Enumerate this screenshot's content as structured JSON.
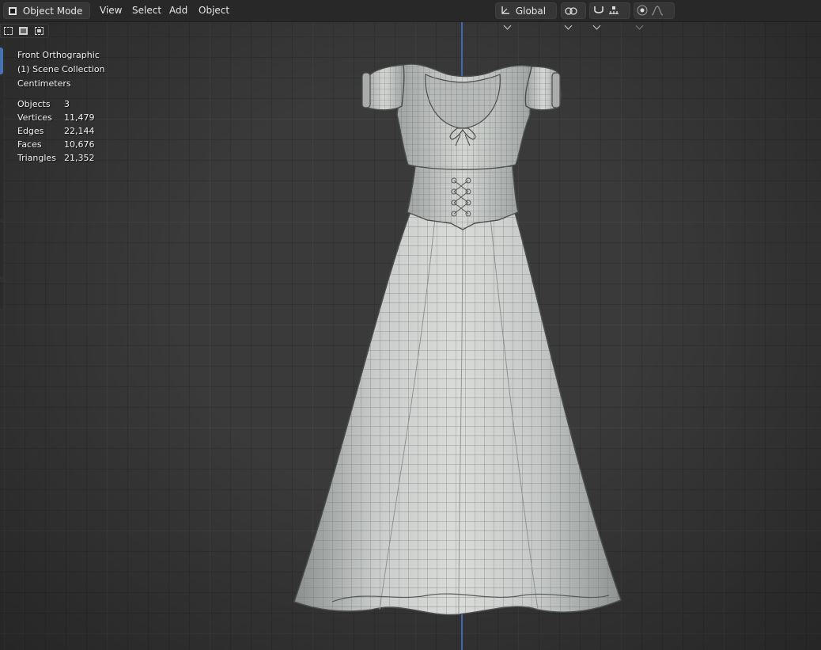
{
  "header": {
    "mode_label": "Object Mode",
    "menu": [
      "View",
      "Select",
      "Add",
      "Object"
    ],
    "orientation_label": "Global"
  },
  "overlay": {
    "view_name": "Front Orthographic",
    "collection": "(1) Scene Collection",
    "units": "Centimeters",
    "stats": [
      {
        "label": "Objects",
        "value": "3"
      },
      {
        "label": "Vertices",
        "value": "11,479"
      },
      {
        "label": "Edges",
        "value": "22,144"
      },
      {
        "label": "Faces",
        "value": "10,676"
      },
      {
        "label": "Triangles",
        "value": "21,352"
      }
    ]
  },
  "icons": {
    "mode": "object-mode-icon",
    "transform_orientation": "transform-orientation-icon",
    "pivot": "pivot-point-icon",
    "snap": "snap-magnet-icon",
    "snap_target": "snap-increment-icon",
    "proportional": "proportional-editing-icon",
    "falloff": "falloff-curve-icon"
  },
  "colors": {
    "axis_z": "#3d6fbf",
    "header_bg": "#282828",
    "viewport_bg": "#3a3a3a",
    "mesh": "#c9ccca"
  }
}
